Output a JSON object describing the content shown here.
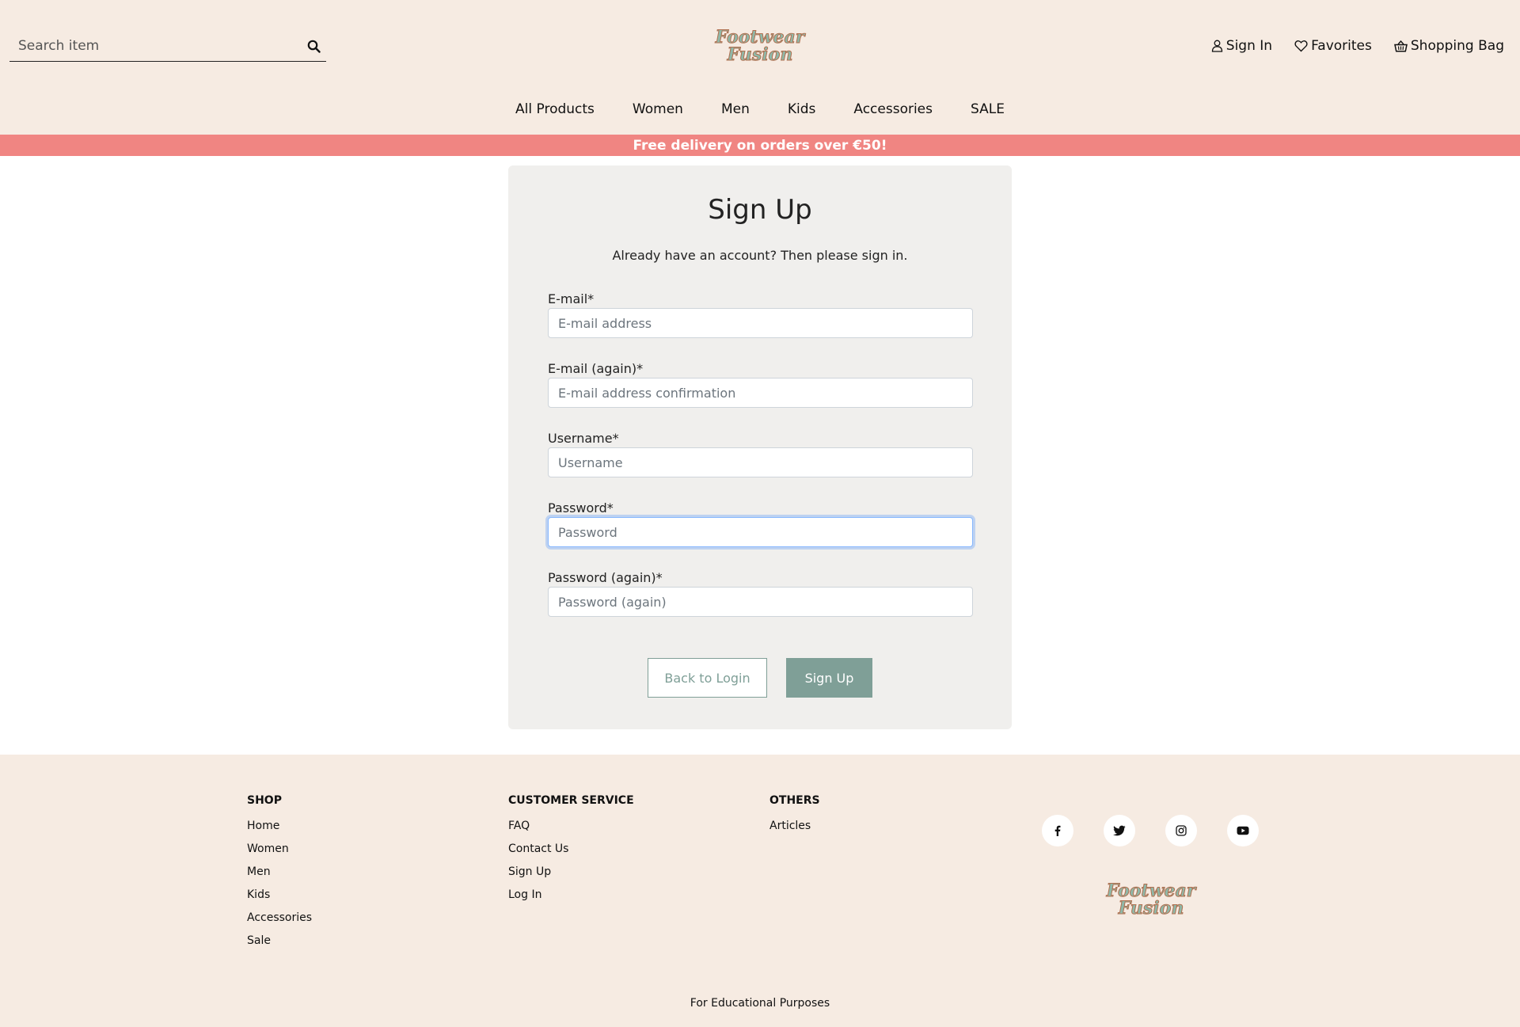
{
  "header": {
    "search_placeholder": "Search item",
    "brand": "Footwear Fusion",
    "account_links": {
      "sign_in": "Sign In",
      "favorites": "Favorites",
      "shopping_bag": "Shopping Bag"
    },
    "main_nav": [
      "All Products",
      "Women",
      "Men",
      "Kids",
      "Accessories",
      "SALE"
    ]
  },
  "promo": "Free delivery on orders over €50!",
  "signup": {
    "title": "Sign Up",
    "subtitle": "Already have an account? Then please sign in.",
    "fields": [
      {
        "label": "E-mail*",
        "placeholder": "E-mail address",
        "value": ""
      },
      {
        "label": "E-mail (again)*",
        "placeholder": "E-mail address confirmation",
        "value": ""
      },
      {
        "label": "Username*",
        "placeholder": "Username",
        "value": ""
      },
      {
        "label": "Password*",
        "placeholder": "Password",
        "value": "",
        "focused": true
      },
      {
        "label": "Password (again)*",
        "placeholder": "Password (again)",
        "value": ""
      }
    ],
    "back_button": "Back to Login",
    "submit_button": "Sign Up"
  },
  "footer": {
    "shop": {
      "heading": "SHOP",
      "links": [
        "Home",
        "Women",
        "Men",
        "Kids",
        "Accessories",
        "Sale"
      ]
    },
    "customer_service": {
      "heading": "CUSTOMER SERVICE",
      "links": [
        "FAQ",
        "Contact Us",
        "Sign Up",
        "Log In"
      ]
    },
    "others": {
      "heading": "OTHERS",
      "links": [
        "Articles"
      ]
    },
    "social_icons": [
      "facebook-icon",
      "twitter-icon",
      "instagram-icon",
      "youtube-icon"
    ],
    "note": "For Educational Purposes"
  },
  "colors": {
    "header_bg": "#f6ebe2",
    "promo_bg": "#f08582",
    "card_bg": "#f0efed",
    "accent": "#7f9f97",
    "logo_fill": "#8fb8a8",
    "logo_stroke": "#b07050"
  }
}
